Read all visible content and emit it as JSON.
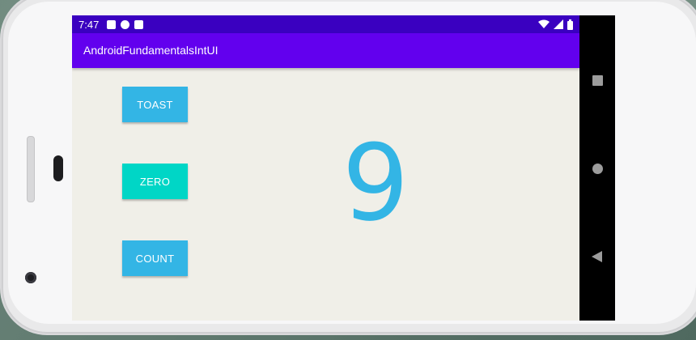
{
  "status_bar": {
    "time": "7:47",
    "icons": [
      "sim-icon",
      "sync-icon",
      "sd-card-icon",
      "wifi-icon",
      "signal-icon",
      "battery-icon"
    ]
  },
  "app_bar": {
    "title": "AndroidFundamentalsIntUI"
  },
  "buttons": {
    "toast": "TOAST",
    "zero": "ZERO",
    "count": "COUNT"
  },
  "counter": {
    "value": "9"
  },
  "colors": {
    "status_bar": "#3a00c0",
    "app_bar": "#6200ee",
    "button_blue": "#33b5e5",
    "button_teal": "#00d6c6",
    "count_text": "#33b5e5",
    "screen_bg": "#f0efe8"
  },
  "nav_bar": {
    "icons": [
      "recents-square-icon",
      "home-circle-icon",
      "back-triangle-icon"
    ]
  }
}
